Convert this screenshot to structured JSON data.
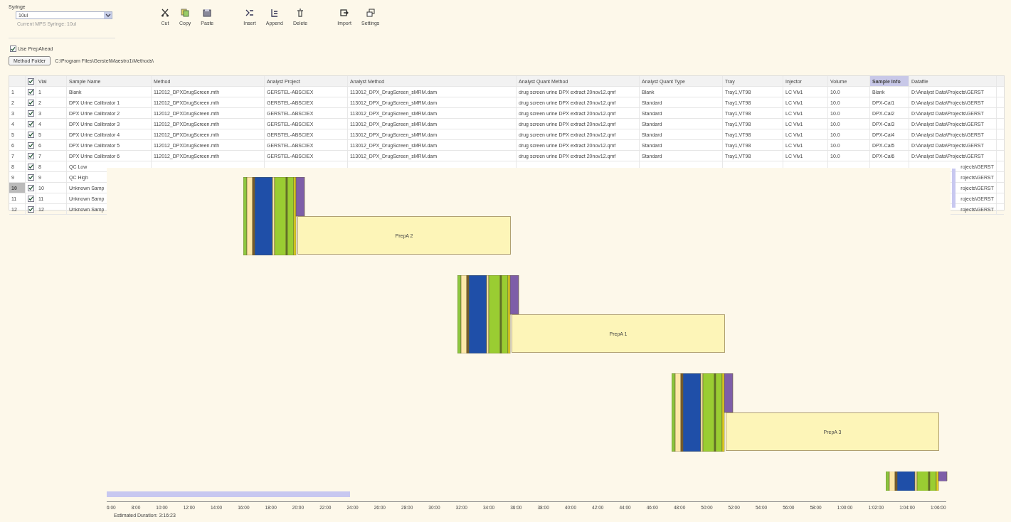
{
  "syringe": {
    "group_label": "Syringe",
    "value": "10ul",
    "hint": "Current MPS Syringe: 10ul"
  },
  "toolbar": [
    {
      "label": "Cut",
      "kind": "cut"
    },
    {
      "label": "Copy",
      "kind": "copy"
    },
    {
      "label": "Paste",
      "kind": "paste"
    },
    {
      "label": "Insert",
      "kind": "insert"
    },
    {
      "label": "Append",
      "kind": "append"
    },
    {
      "label": "Delete",
      "kind": "delete"
    },
    {
      "label": "Import",
      "kind": "import"
    },
    {
      "label": "Settings",
      "kind": "settings"
    }
  ],
  "use_prepahead": {
    "label": "Use PrepAhead",
    "checked": true
  },
  "method_folder": {
    "button": "Method Folder",
    "path": "C:\\Program Files\\Gerstel\\Maestro1\\Methods\\"
  },
  "table": {
    "columns": [
      {
        "label": "Vial",
        "selected": false
      },
      {
        "label": "Sample Name",
        "selected": false
      },
      {
        "label": "Method",
        "selected": false
      },
      {
        "label": "Analyst Project",
        "selected": false
      },
      {
        "label": "Analyst Method",
        "selected": false
      },
      {
        "label": "Analyst Quant Method",
        "selected": false
      },
      {
        "label": "Analyst Quant Type",
        "selected": false
      },
      {
        "label": "Tray",
        "selected": false
      },
      {
        "label": "Injector",
        "selected": false
      },
      {
        "label": "Volume",
        "selected": false
      },
      {
        "label": "Sample Info",
        "selected": true
      },
      {
        "label": "Datafile",
        "selected": false
      }
    ],
    "all_checked": true,
    "rows": [
      {
        "kind": "full",
        "index": "1",
        "checked": true,
        "selected": false,
        "cells": [
          "1",
          "Blank",
          "112012_DPXDrugScreen.mth",
          "GERSTEL-ABSCIEX",
          "113012_DPX_DrugScreen_sMRM.dam",
          "drug screen urine DPX extract 20nov12.qmf",
          "Blank",
          "Tray1,VT98",
          "LC Vlv1",
          "10.0",
          "Blank",
          "D:\\Analyst Data\\Projects\\GERST"
        ]
      },
      {
        "kind": "full",
        "index": "2",
        "checked": true,
        "selected": false,
        "cells": [
          "2",
          "DPX Urine Calibrator 1",
          "112012_DPXDrugScreen.mth",
          "GERSTEL-ABSCIEX",
          "113012_DPX_DrugScreen_sMRM.dam",
          "drug screen urine DPX extract 20nov12.qmf",
          "Standard",
          "Tray1,VT98",
          "LC Vlv1",
          "10.0",
          "DPX-Cal1",
          "D:\\Analyst Data\\Projects\\GERST"
        ]
      },
      {
        "kind": "full",
        "index": "3",
        "checked": true,
        "selected": false,
        "cells": [
          "3",
          "DPX Urine Calibrator 2",
          "112012_DPXDrugScreen.mth",
          "GERSTEL-ABSCIEX",
          "113012_DPX_DrugScreen_sMRM.dam",
          "drug screen urine DPX extract 20nov12.qmf",
          "Standard",
          "Tray1,VT98",
          "LC Vlv1",
          "10.0",
          "DPX-Cal2",
          "D:\\Analyst Data\\Projects\\GERST"
        ]
      },
      {
        "kind": "full",
        "index": "4",
        "checked": true,
        "selected": false,
        "cells": [
          "4",
          "DPX Urine Calibrator 3",
          "112012_DPXDrugScreen.mth",
          "GERSTEL-ABSCIEX",
          "113012_DPX_DrugScreen_sMRM.dam",
          "drug screen urine DPX extract 20nov12.qmf",
          "Standard",
          "Tray1,VT98",
          "LC Vlv1",
          "10.0",
          "DPX-Cal3",
          "D:\\Analyst Data\\Projects\\GERST"
        ]
      },
      {
        "kind": "full",
        "index": "5",
        "checked": true,
        "selected": false,
        "cells": [
          "5",
          "DPX Urine Calibrator 4",
          "112012_DPXDrugScreen.mth",
          "GERSTEL-ABSCIEX",
          "113012_DPX_DrugScreen_sMRM.dam",
          "drug screen urine DPX extract 20nov12.qmf",
          "Standard",
          "Tray1,VT98",
          "LC Vlv1",
          "10.0",
          "DPX-Cal4",
          "D:\\Analyst Data\\Projects\\GERST"
        ]
      },
      {
        "kind": "full",
        "index": "6",
        "checked": true,
        "selected": false,
        "cells": [
          "6",
          "DPX Urine Calibrator 5",
          "112012_DPXDrugScreen.mth",
          "GERSTEL-ABSCIEX",
          "113012_DPX_DrugScreen_sMRM.dam",
          "drug screen urine DPX extract 20nov12.qmf",
          "Standard",
          "Tray1,VT98",
          "LC Vlv1",
          "10.0",
          "DPX-Cal5",
          "D:\\Analyst Data\\Projects\\GERST"
        ]
      },
      {
        "kind": "full",
        "index": "7",
        "checked": true,
        "selected": false,
        "cells": [
          "7",
          "DPX Urine Calibrator 6",
          "112012_DPXDrugScreen.mth",
          "GERSTEL-ABSCIEX",
          "113012_DPX_DrugScreen_sMRM.dam",
          "drug screen urine DPX extract 20nov12.qmf",
          "Standard",
          "Tray1,VT98",
          "LC Vlv1",
          "10.0",
          "DPX-Cal6",
          "D:\\Analyst Data\\Projects\\GERST"
        ]
      },
      {
        "kind": "covered",
        "index": "8",
        "checked": true,
        "selected": false,
        "vial": "8",
        "sample_name": "QC Low",
        "datafile": "rojects\\GERST"
      },
      {
        "kind": "covered",
        "index": "9",
        "checked": true,
        "selected": false,
        "vial": "9",
        "sample_name": "QC High",
        "datafile": "rojects\\GERST"
      },
      {
        "kind": "covered",
        "index": "10",
        "checked": true,
        "selected": true,
        "vial": "10",
        "sample_name": "Unknown Samp",
        "datafile": "rojects\\GERST"
      },
      {
        "kind": "covered",
        "index": "11",
        "checked": true,
        "selected": false,
        "vial": "11",
        "sample_name": "Unknown Samp",
        "datafile": "rojects\\GERST"
      },
      {
        "kind": "covered",
        "index": "12",
        "checked": true,
        "selected": false,
        "vial": "12",
        "sample_name": "Unknown Samp",
        "datafile": "rojects\\GERST"
      }
    ]
  },
  "schedule": {
    "blocks": [
      {
        "label": "PrepA 2"
      },
      {
        "label": "PrepA 1"
      },
      {
        "label": "PrepA 3"
      },
      {
        "kind": "partial"
      }
    ],
    "axis_labels": [
      "6:00",
      "8:00",
      "10:00",
      "12:00",
      "14:00",
      "16:00",
      "18:00",
      "20:00",
      "22:00",
      "24:00",
      "26:00",
      "28:00",
      "30:00",
      "32:00",
      "34:00",
      "36:00",
      "38:00",
      "40:00",
      "42:00",
      "44:00",
      "46:00",
      "48:00",
      "50:00",
      "52:00",
      "54:00",
      "56:00",
      "58:00",
      "1:00:00",
      "1:02:00",
      "1:04:00",
      "1:06:00"
    ],
    "estimated_duration": "Estimated Duration: 3:16:23"
  }
}
